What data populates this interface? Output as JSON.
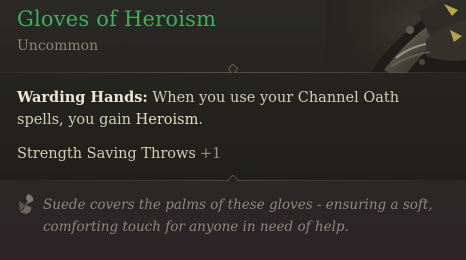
{
  "item": {
    "name": "Gloves of Heroism",
    "rarity": "Uncommon",
    "name_color": "#3fae5d",
    "art_icon": "gauntlet-art-icon"
  },
  "passive": {
    "name": "Warding Hands:",
    "text_before": " When you use your Channel Oath spells, you gain ",
    "highlight": "Heroism",
    "text_after": "."
  },
  "stat": {
    "label": "Strength Saving Throws",
    "bonus": "+1"
  },
  "flavor": {
    "icon": "quill-icon",
    "text": "Suede covers the palms of these gloves - ensuring a soft, comforting touch for anyone in need of help."
  }
}
